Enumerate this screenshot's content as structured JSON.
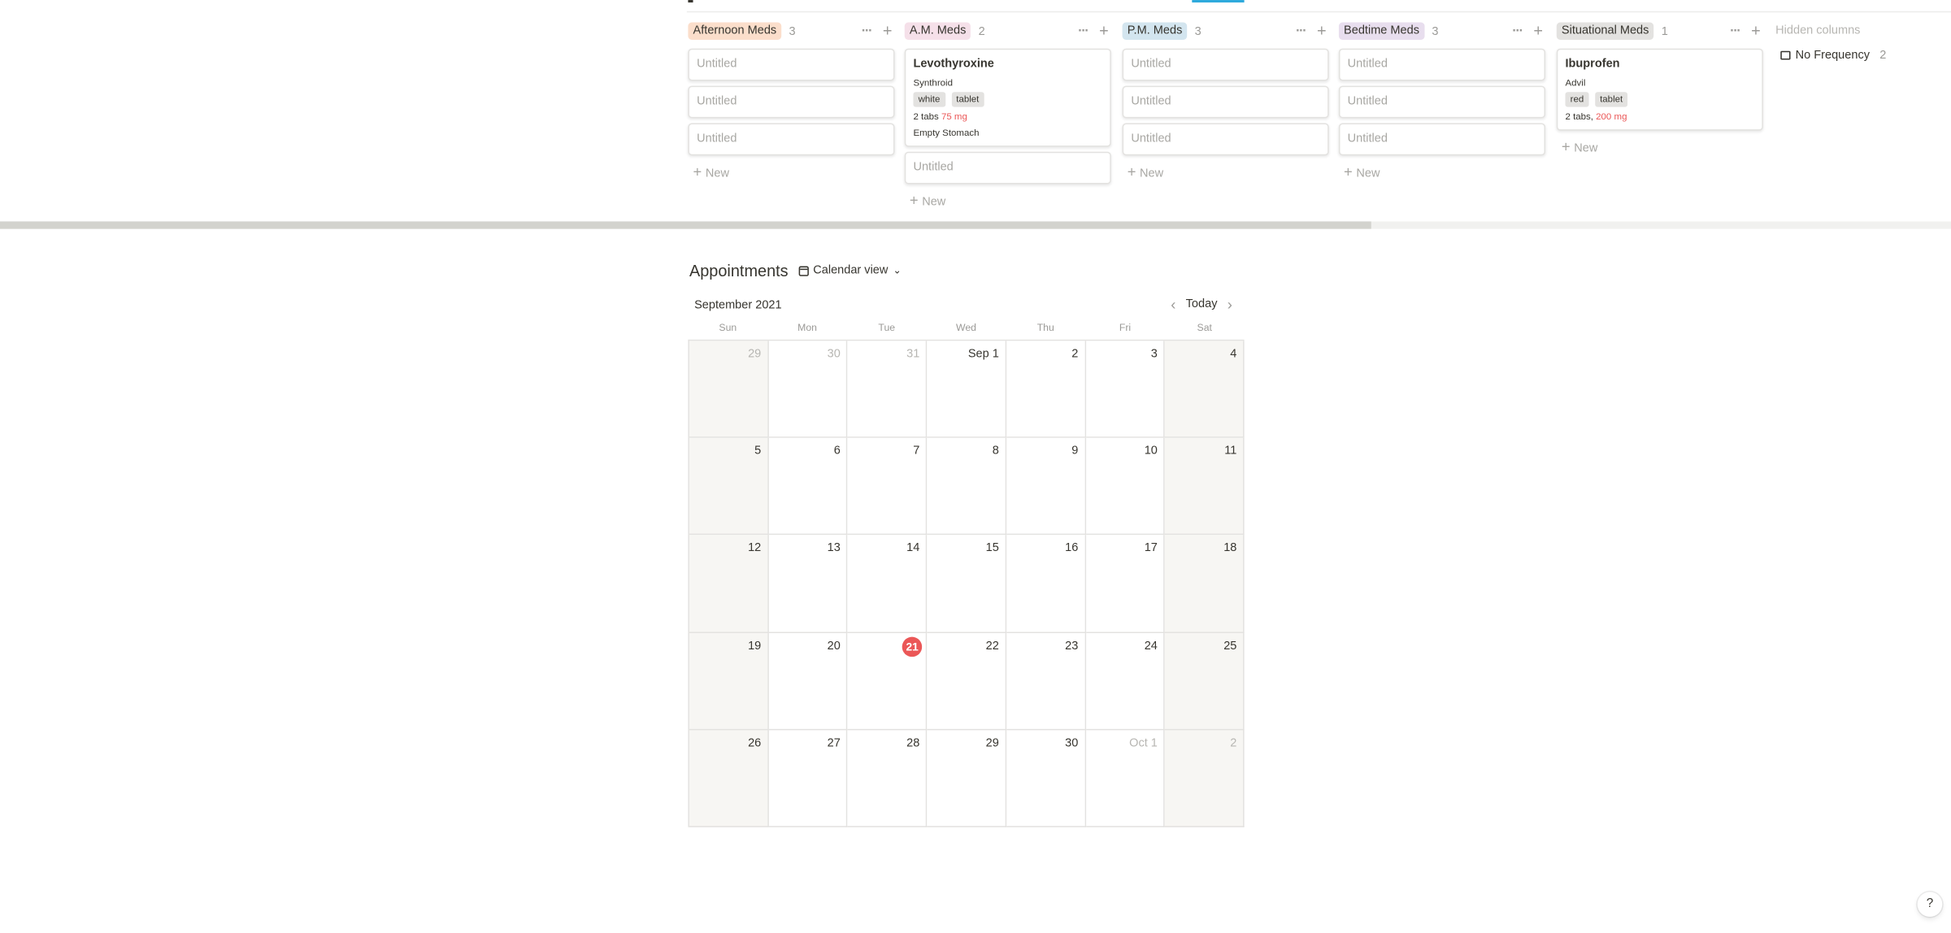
{
  "board": {
    "columns": [
      {
        "label": "Afternoon Meds",
        "count": "3",
        "color": "#fbdecb",
        "cards": [
          {
            "title": "Untitled"
          },
          {
            "title": "Untitled"
          },
          {
            "title": "Untitled"
          }
        ],
        "new_label": "New"
      },
      {
        "label": "A.M. Meds",
        "count": "2",
        "color": "#f5e0e9",
        "cards": [
          {
            "title": "Levothyroxine",
            "brand": "Synthroid",
            "tags": [
              "white",
              "tablet"
            ],
            "dose": "2 tabs",
            "strength": "75 mg",
            "note": "Empty Stomach"
          },
          {
            "title": "Untitled"
          }
        ],
        "new_label": "New"
      },
      {
        "label": "P.M. Meds",
        "count": "3",
        "color": "#d3e5ef",
        "cards": [
          {
            "title": "Untitled"
          },
          {
            "title": "Untitled"
          },
          {
            "title": "Untitled"
          }
        ],
        "new_label": "New"
      },
      {
        "label": "Bedtime Meds",
        "count": "3",
        "color": "#e8deee",
        "cards": [
          {
            "title": "Untitled"
          },
          {
            "title": "Untitled"
          },
          {
            "title": "Untitled"
          }
        ],
        "new_label": "New"
      },
      {
        "label": "Situational Meds",
        "count": "1",
        "color": "#e3e2e0",
        "cards": [
          {
            "title": "Ibuprofen",
            "brand": "Advil",
            "tags": [
              "red",
              "tablet"
            ],
            "dose": "2 tabs,",
            "strength": "200 mg"
          }
        ],
        "new_label": "New"
      }
    ],
    "hidden_columns_label": "Hidden columns",
    "hidden_columns": [
      {
        "label": "No Frequency",
        "count": "2"
      }
    ]
  },
  "appointments": {
    "title": "Appointments",
    "view_label": "Calendar view",
    "month": "September 2021",
    "today_label": "Today",
    "weekdays": [
      "Sun",
      "Mon",
      "Tue",
      "Wed",
      "Thu",
      "Fri",
      "Sat"
    ],
    "days": [
      {
        "n": "29",
        "muted": true
      },
      {
        "n": "30",
        "muted": true
      },
      {
        "n": "31",
        "muted": true
      },
      {
        "n": "Sep 1"
      },
      {
        "n": "2"
      },
      {
        "n": "3"
      },
      {
        "n": "4"
      },
      {
        "n": "5"
      },
      {
        "n": "6"
      },
      {
        "n": "7"
      },
      {
        "n": "8"
      },
      {
        "n": "9"
      },
      {
        "n": "10"
      },
      {
        "n": "11"
      },
      {
        "n": "12"
      },
      {
        "n": "13"
      },
      {
        "n": "14"
      },
      {
        "n": "15"
      },
      {
        "n": "16"
      },
      {
        "n": "17"
      },
      {
        "n": "18"
      },
      {
        "n": "19"
      },
      {
        "n": "20"
      },
      {
        "n": "21",
        "today": true
      },
      {
        "n": "22"
      },
      {
        "n": "23"
      },
      {
        "n": "24"
      },
      {
        "n": "25"
      },
      {
        "n": "26"
      },
      {
        "n": "27"
      },
      {
        "n": "28"
      },
      {
        "n": "29"
      },
      {
        "n": "30"
      },
      {
        "n": "Oct 1",
        "muted": true
      },
      {
        "n": "2",
        "muted": true
      }
    ]
  },
  "help_label": "?",
  "colors": {
    "accent": "#2eaadc",
    "today": "#eb5757",
    "strength": "#eb5757"
  }
}
